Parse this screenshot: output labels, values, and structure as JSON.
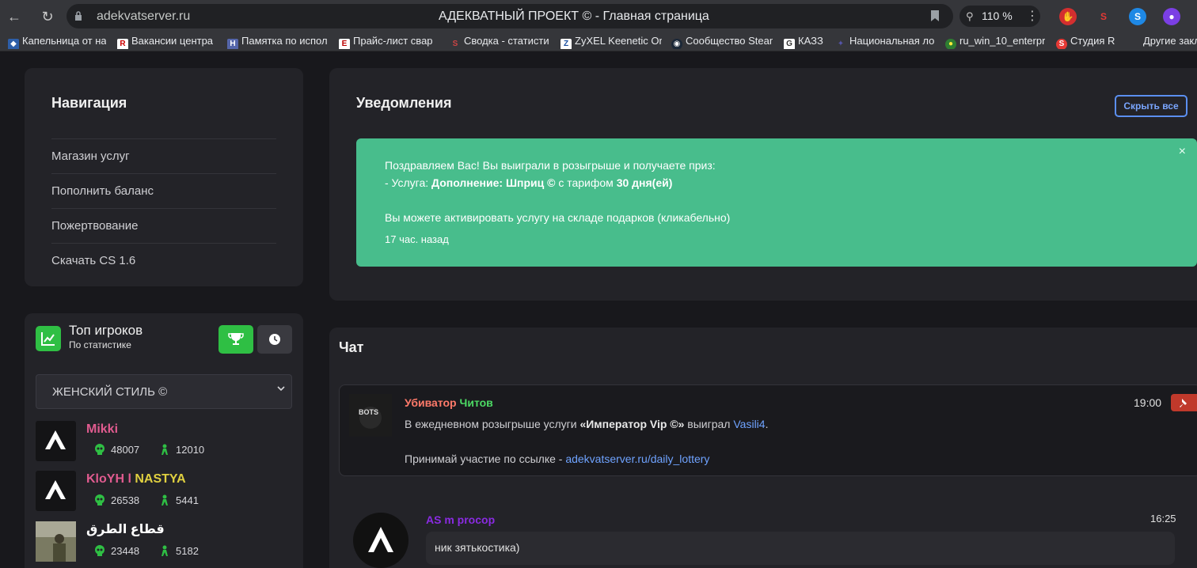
{
  "browser": {
    "url": "adekvatserver.ru",
    "title": "АДЕКВАТНЫЙ ПРОЕКТ © - Главная страница",
    "zoom": "110 %",
    "bookmarks": [
      "Капельница от на",
      "Вакансии центра",
      "Памятка по испол",
      "Прайс-лист свар",
      "Сводка - статисти",
      "ZyXEL Keenetic Om",
      "Сообщество Steam",
      "КАЗЗ",
      "Национальная ло",
      "ru_win_10_enterpr",
      "Студия R",
      "Другие закл"
    ]
  },
  "navigation": {
    "title": "Навигация",
    "items": [
      "Магазин услуг",
      "Пополнить баланс",
      "Пожертвование",
      "Скачать CS 1.6"
    ]
  },
  "notifications": {
    "title": "Уведомления",
    "hide_all": "Скрыть все",
    "close": "×",
    "line1": "Поздравляем Вас! Вы выиграли в розыгрыше и получаете приз:",
    "line2_prefix": "- Услуга: ",
    "line2_service": "Дополнение: Шприц ©",
    "line2_mid": " с тарифом ",
    "line2_term": "30 дня(ей)",
    "line3": "Вы можете активировать услугу на складе подарков (кликабельно)",
    "time": "17 час. назад",
    "accent": "#48bd8c"
  },
  "top_players": {
    "title": "Топ игроков",
    "subtitle": "По статистике",
    "selected_server": "ЖЕНСКИЙ СТИЛЬ ©",
    "players": [
      {
        "name": "Mikki",
        "kills": "48007",
        "score": "12010",
        "color": "#e05b8f"
      },
      {
        "name": "KloYH l NASTYA",
        "kills": "26538",
        "score": "5441",
        "color": "#e0d040"
      },
      {
        "name": "قطاع الطرق",
        "kills": "23448",
        "score": "5182",
        "color": "#ffffff"
      }
    ]
  },
  "chat": {
    "title": "Чат",
    "messages": [
      {
        "avatar_text": "BOTS",
        "name_part1": "Убиватор",
        "name_part2": "Читов",
        "time": "19:00",
        "text_prefix": "В ежедневном розыгрыше услуги ",
        "text_service": "«Император Vip ©»",
        "text_mid": " выиграл ",
        "text_winner": "Vasili4",
        "text_end": ".",
        "line2_prefix": "Принимай участие по ссылке - ",
        "line2_link": "adekvatserver.ru/daily_lottery"
      },
      {
        "name": "AS m procop",
        "time": "16:25",
        "text": "ник зятькостика)"
      }
    ]
  }
}
